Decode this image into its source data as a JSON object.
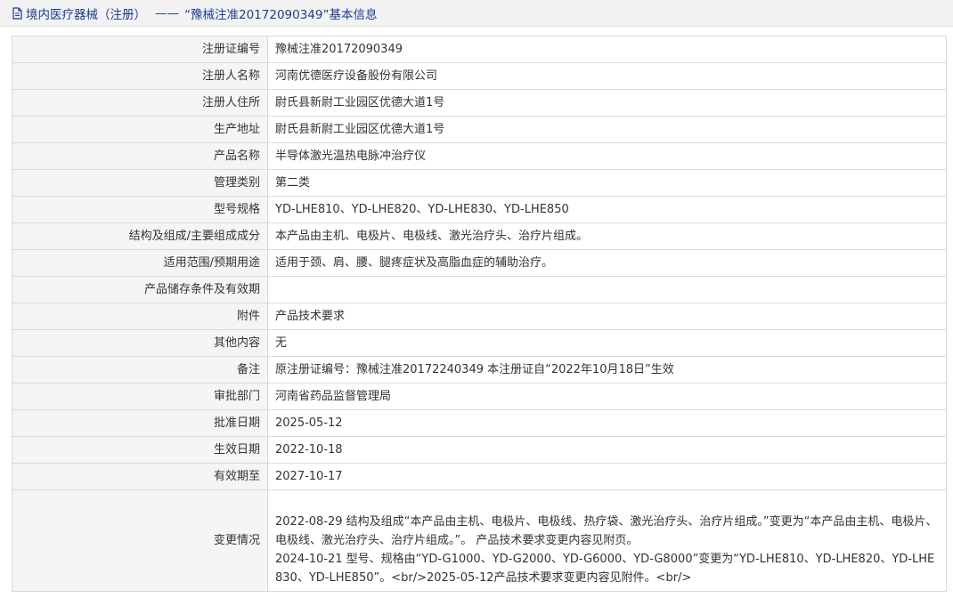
{
  "header": {
    "icon": "document-icon",
    "category": "境内医疗器械（注册）",
    "separator": "——",
    "title": "“豫械注准20172090349”基本信息"
  },
  "rows": [
    {
      "label": "注册证编号",
      "value": "豫械注准20172090349"
    },
    {
      "label": "注册人名称",
      "value": "河南优德医疗设备股份有限公司"
    },
    {
      "label": "注册人住所",
      "value": "尉氏县新尉工业园区优德大道1号"
    },
    {
      "label": "生产地址",
      "value": "尉氏县新尉工业园区优德大道1号"
    },
    {
      "label": "产品名称",
      "value": "半导体激光温热电脉冲治疗仪"
    },
    {
      "label": "管理类别",
      "value": "第二类"
    },
    {
      "label": "型号规格",
      "value": "YD-LHE810、YD-LHE820、YD-LHE830、YD-LHE850"
    },
    {
      "label": "结构及组成/主要组成成分",
      "value": "本产品由主机、电极片、电极线、激光治疗头、治疗片组成。"
    },
    {
      "label": "适用范围/预期用途",
      "value": "适用于颈、肩、腰、腿疼症状及高脂血症的辅助治疗。"
    },
    {
      "label": "产品储存条件及有效期",
      "value": ""
    },
    {
      "label": "附件",
      "value": "产品技术要求"
    },
    {
      "label": "其他内容",
      "value": "无"
    },
    {
      "label": "备注",
      "value": "原注册证编号：豫械注准20172240349 本注册证自“2022年10月18日”生效"
    },
    {
      "label": "审批部门",
      "value": "河南省药品监督管理局"
    },
    {
      "label": "批准日期",
      "value": "2025-05-12"
    },
    {
      "label": "生效日期",
      "value": "2022-10-18"
    },
    {
      "label": "有效期至",
      "value": "2027-10-17"
    }
  ],
  "change": {
    "label": "变更情况",
    "line1": "2022-08-29 结构及组成“本产品由主机、电极片、电极线、热疗袋、激光治疗头、治疗片组成。”变更为“本产品由主机、电极片、电极线、激光治疗头、治疗片组成。”。 产品技术要求变更内容见附页。",
    "line2": "2024-10-21 型号、规格由“YD-G1000、YD-G2000、YD-G6000、YD-G8000”变更为“YD-LHE810、YD-LHE820、YD-LHE830、YD-LHE850”。<br/>2025-05-12产品技术要求变更内容见附件。<br/>"
  }
}
